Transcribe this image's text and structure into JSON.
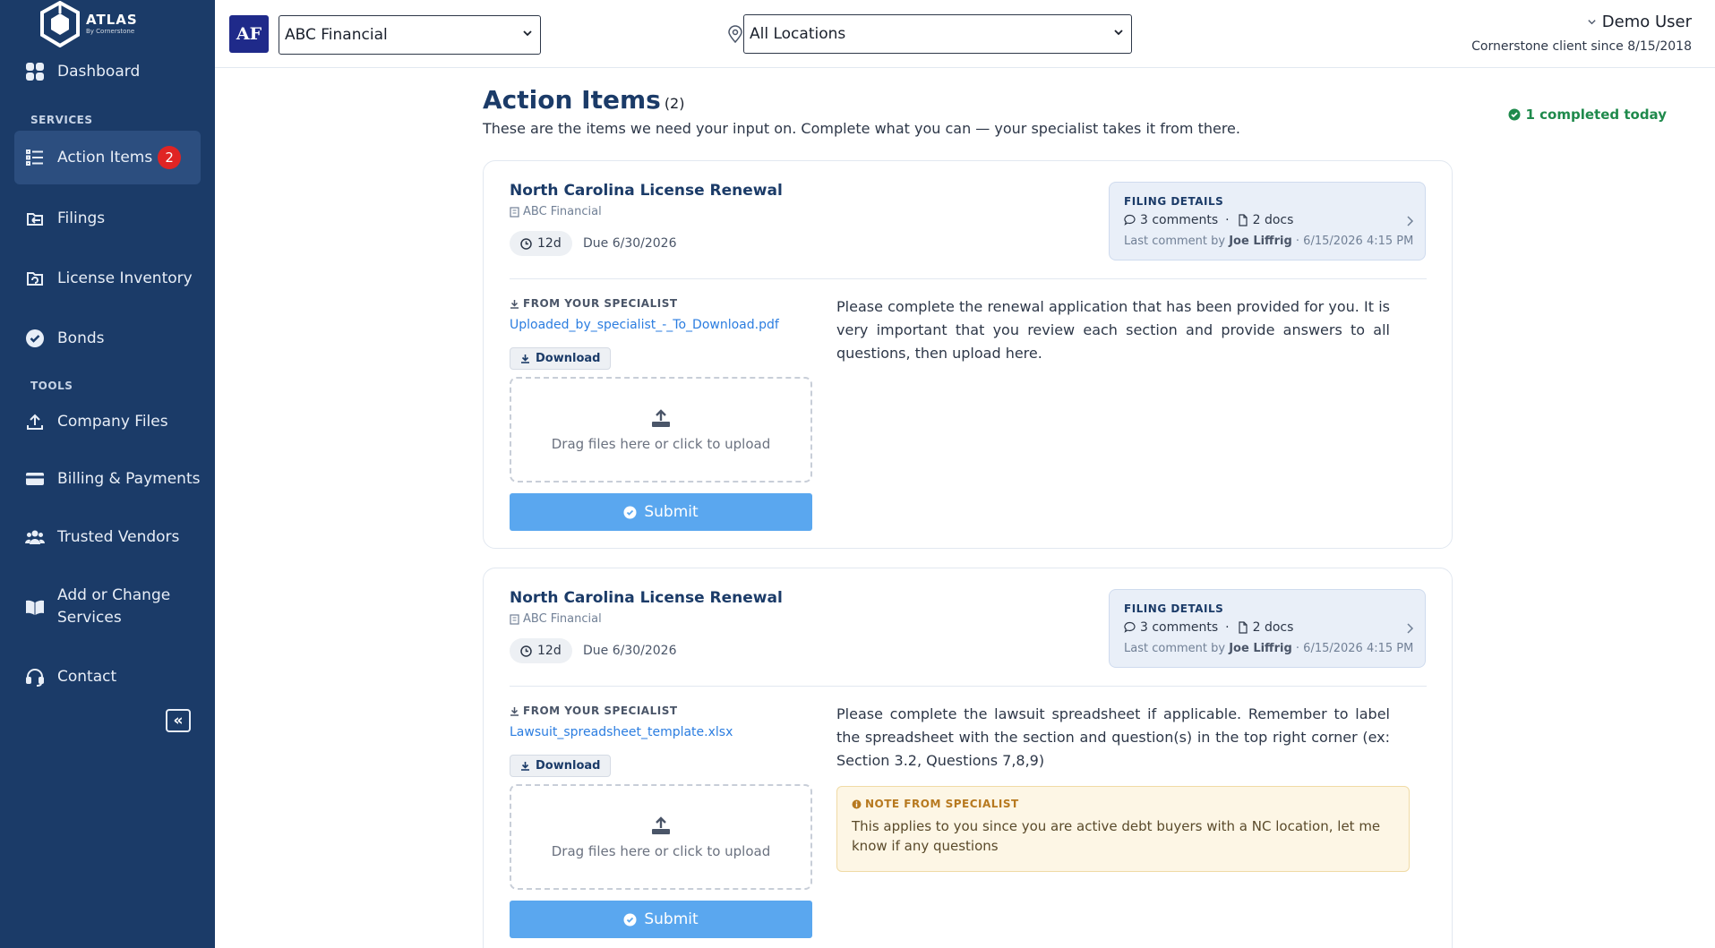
{
  "sidebar": {
    "logo": {
      "title": "ATLAS",
      "subtitle": "By Cornerstone"
    },
    "dashboard": "Dashboard",
    "services_label": "SERVICES",
    "action_items": {
      "label": "Action Items",
      "badge": "2"
    },
    "filings": "Filings",
    "license_inventory": "License Inventory",
    "bonds": "Bonds",
    "tools_label": "TOOLS",
    "company_files": "Company Files",
    "billing": "Billing & Payments",
    "trusted_vendors": "Trusted Vendors",
    "add_change_line1": "Add or Change",
    "add_change_line2": "Services",
    "contact": "Contact"
  },
  "topbar": {
    "company_initials": "AF",
    "company_selected": "ABC Financial",
    "location_selected": "All Locations",
    "user_name": "Demo User",
    "user_since": "Cornerstone client since 8/15/2018"
  },
  "page": {
    "title": "Action Items",
    "count": "(2)",
    "subtitle": "These are the items we need your input on. Complete what you can — your specialist takes it from there.",
    "completed_today": "1 completed today"
  },
  "cards": [
    {
      "title": "North Carolina License Renewal",
      "company": "ABC Financial",
      "days": "12d",
      "due": "Due 6/30/2026",
      "filing_label": "FILING DETAILS",
      "comments": "3 comments",
      "sep": "·",
      "docs": "2 docs",
      "last_prefix": "Last comment by",
      "last_by": "Joe Liffrig",
      "last_time": "· 6/15/2026 4:15 PM",
      "spec_label": "FROM YOUR SPECIALIST",
      "file": "Uploaded_by_specialist_-_To_Download.pdf",
      "download": "Download",
      "dropzone": "Drag files here or click to upload",
      "submit": "Submit",
      "instructions": "Please complete the renewal application that has been provided for you. It is very important that you review each section and provide answers to all questions, then upload here."
    },
    {
      "title": "North Carolina License Renewal",
      "company": "ABC Financial",
      "days": "12d",
      "due": "Due 6/30/2026",
      "filing_label": "FILING DETAILS",
      "comments": "3 comments",
      "sep": "·",
      "docs": "2 docs",
      "last_prefix": "Last comment by",
      "last_by": "Joe Liffrig",
      "last_time": "· 6/15/2026 4:15 PM",
      "spec_label": "FROM YOUR SPECIALIST",
      "file": "Lawsuit_spreadsheet_template.xlsx",
      "download": "Download",
      "dropzone": "Drag files here or click to upload",
      "submit": "Submit",
      "instructions": "Please complete the lawsuit spreadsheet if applicable. Remember to label the spreadsheet with the section and question(s) in the top right corner (ex: Section 3.2, Questions 7,8,9)",
      "note_label": "NOTE FROM SPECIALIST",
      "note_text": "This applies to you since you are active debt buyers with a NC location, let me know if any questions"
    }
  ],
  "colors": {
    "sidebar_bg": "#1b3b68",
    "accent": "#1b3b68",
    "badge": "#e02424",
    "submit": "#5aa7ef",
    "success": "#1f8a4c"
  }
}
